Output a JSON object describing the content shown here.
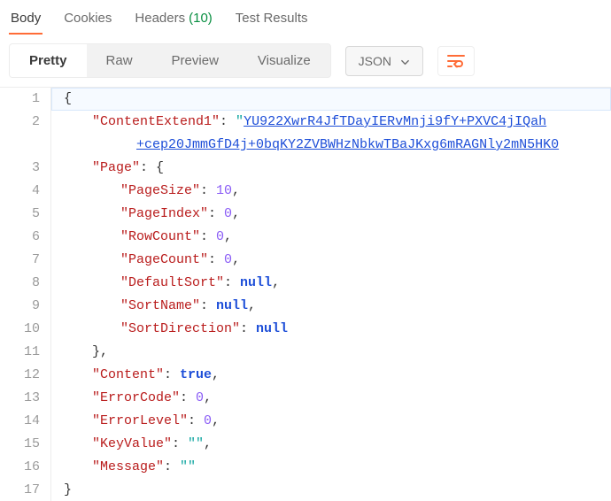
{
  "tabs": {
    "body": "Body",
    "cookies": "Cookies",
    "headers": "Headers",
    "headers_count": "(10)",
    "test_results": "Test Results"
  },
  "view_buttons": {
    "pretty": "Pretty",
    "raw": "Raw",
    "preview": "Preview",
    "visualize": "Visualize"
  },
  "format_dropdown": {
    "selected": "JSON"
  },
  "icons": {
    "wrap": "line-wrap-icon",
    "chevron_down": "chevron-down-icon"
  },
  "code": {
    "l1": "{",
    "l2_key": "\"ContentExtend1\"",
    "l2_sep": ": ",
    "l2_val_q": "\"",
    "l2_val_text": "YU922XwrR4JfTDayIERvMnji9fY+PXVC4jIQah",
    "l2b_text": "+cep20JmmGfD4j+0bqKY2ZVBWHzNbkwTBaJKxg6mRAGNly2mN5HK0",
    "l3_key": "\"Page\"",
    "l3_sep": ": ",
    "l3_val": "{",
    "l4_key": "\"PageSize\"",
    "l4_val": "10",
    "l5_key": "\"PageIndex\"",
    "l5_val": "0",
    "l6_key": "\"RowCount\"",
    "l6_val": "0",
    "l7_key": "\"PageCount\"",
    "l7_val": "0",
    "l8_key": "\"DefaultSort\"",
    "l8_val": "null",
    "l9_key": "\"SortName\"",
    "l9_val": "null",
    "l10_key": "\"SortDirection\"",
    "l10_val": "null",
    "l11": "},",
    "l12_key": "\"Content\"",
    "l12_val": "true",
    "l13_key": "\"ErrorCode\"",
    "l13_val": "0",
    "l14_key": "\"ErrorLevel\"",
    "l14_val": "0",
    "l15_key": "\"KeyValue\"",
    "l15_val": "\"\"",
    "l16_key": "\"Message\"",
    "l16_val": "\"\"",
    "l17": "}",
    "comma": ",",
    "colon": ": "
  },
  "line_numbers": [
    "1",
    "2",
    "3",
    "4",
    "5",
    "6",
    "7",
    "8",
    "9",
    "10",
    "11",
    "12",
    "13",
    "14",
    "15",
    "16",
    "17"
  ]
}
